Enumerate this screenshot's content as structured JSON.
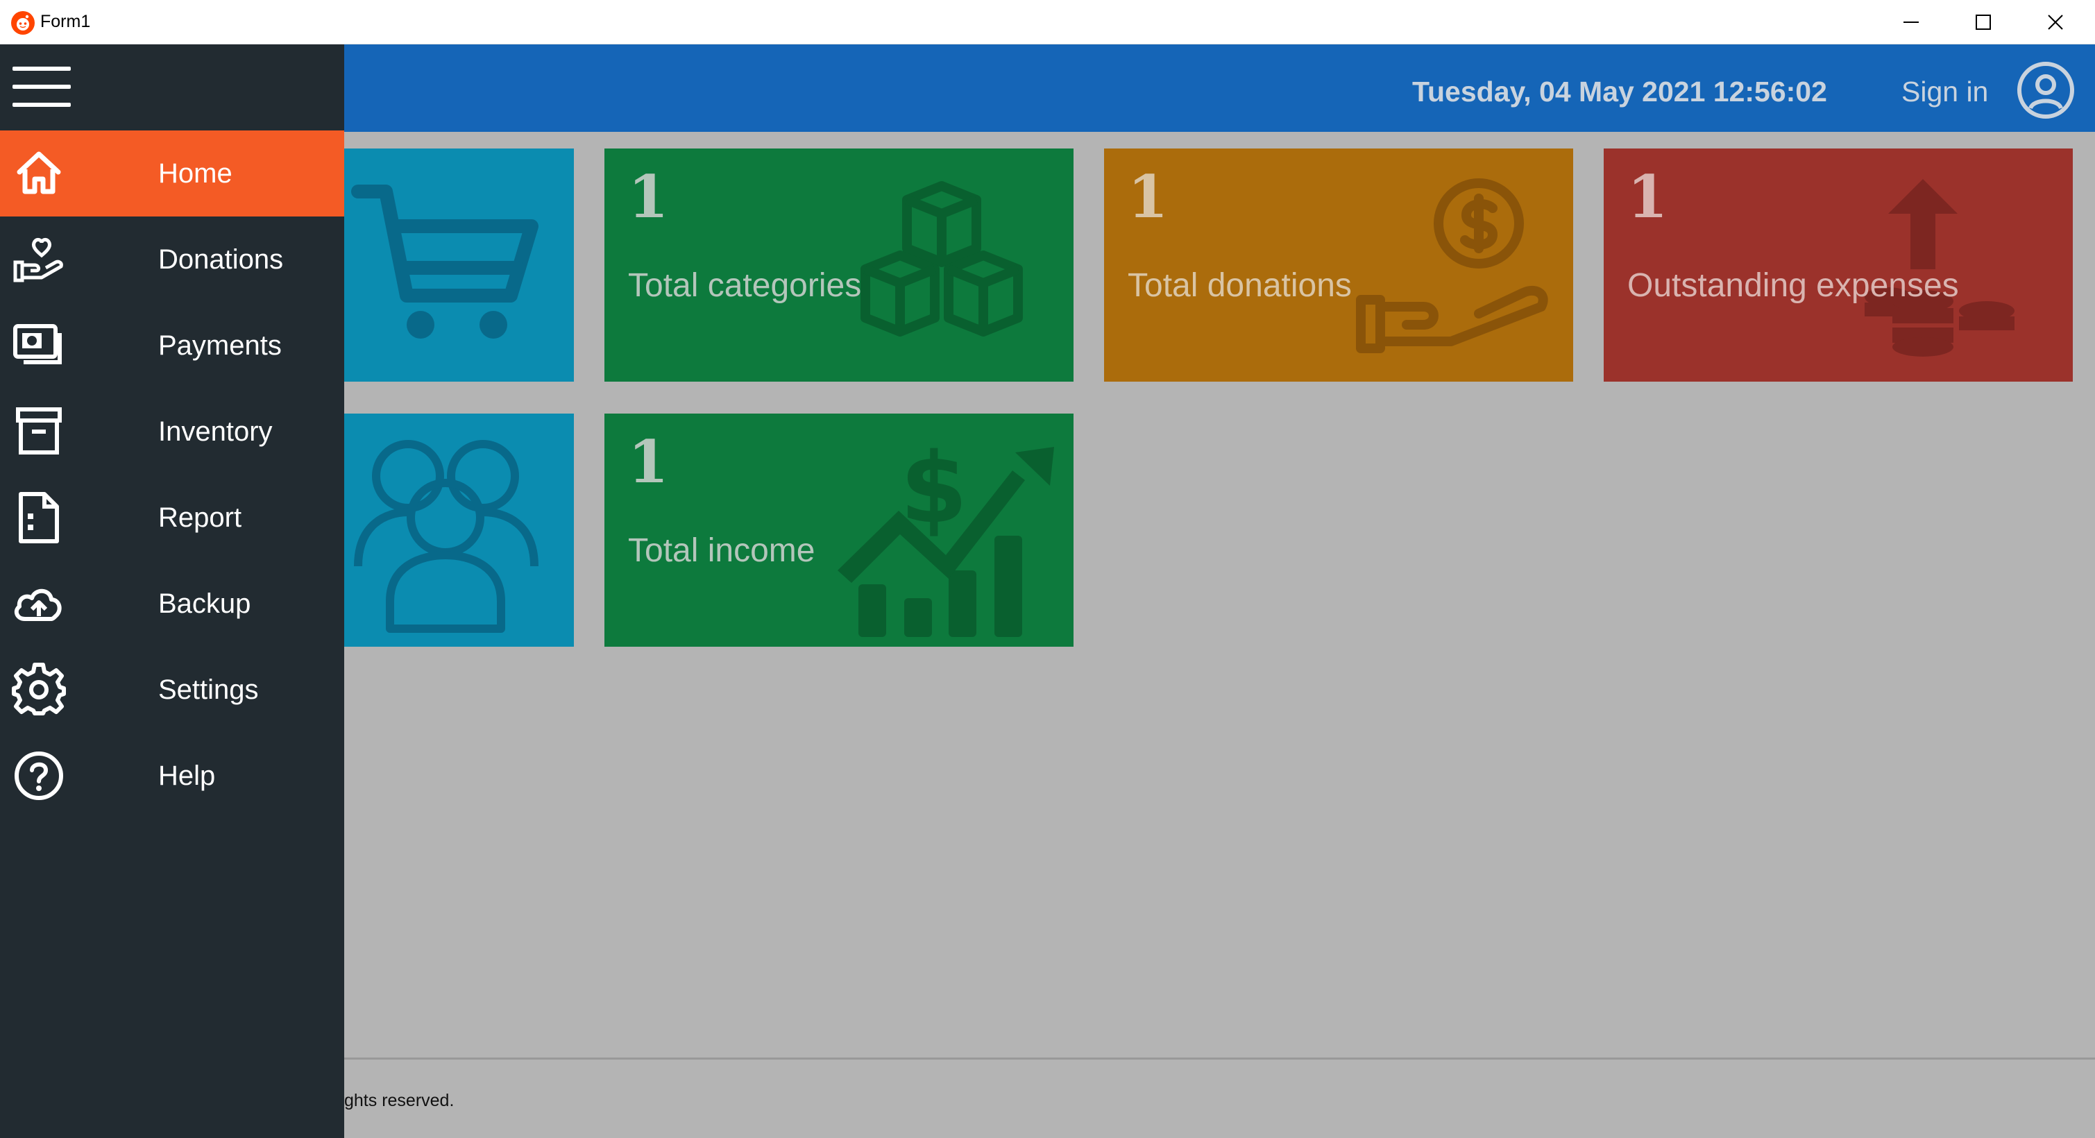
{
  "window": {
    "title": "Form1"
  },
  "header": {
    "datetime": "Tuesday, 04 May 2021 12:56:02",
    "signin_label": "Sign in",
    "background": "#1565b7"
  },
  "sidebar": {
    "background": "#222b31",
    "active_color": "#f45b25",
    "items": [
      {
        "label": "Home",
        "icon": "home-icon",
        "active": true
      },
      {
        "label": "Donations",
        "icon": "donation-icon",
        "active": false
      },
      {
        "label": "Payments",
        "icon": "payments-icon",
        "active": false
      },
      {
        "label": "Inventory",
        "icon": "inventory-icon",
        "active": false
      },
      {
        "label": "Report",
        "icon": "report-icon",
        "active": false
      },
      {
        "label": "Backup",
        "icon": "cloud-upload-icon",
        "active": false
      },
      {
        "label": "Settings",
        "icon": "gear-icon",
        "active": false
      },
      {
        "label": "Help",
        "icon": "help-icon",
        "active": false
      }
    ]
  },
  "tiles": [
    {
      "key": "orders",
      "count": "",
      "label": "",
      "color": "#0b8cb0",
      "icon": "shopping-cart-icon"
    },
    {
      "key": "categories",
      "count": "1",
      "label": "Total categories",
      "color": "#0d7a3d",
      "icon": "boxes-icon"
    },
    {
      "key": "donations",
      "count": "1",
      "label": "Total donations",
      "color": "#ab6c0c",
      "icon": "donation-hand-icon"
    },
    {
      "key": "expenses",
      "count": "1",
      "label": "Outstanding expenses",
      "color": "#9b322b",
      "icon": "coins-arrow-up-icon"
    },
    {
      "key": "members",
      "count": "",
      "label": "",
      "color": "#0b8cb0",
      "icon": "users-icon"
    },
    {
      "key": "income",
      "count": "1",
      "label": "Total income",
      "color": "#0d7a3d",
      "icon": "income-chart-icon"
    }
  ],
  "footer": {
    "text": "ghts reserved."
  }
}
